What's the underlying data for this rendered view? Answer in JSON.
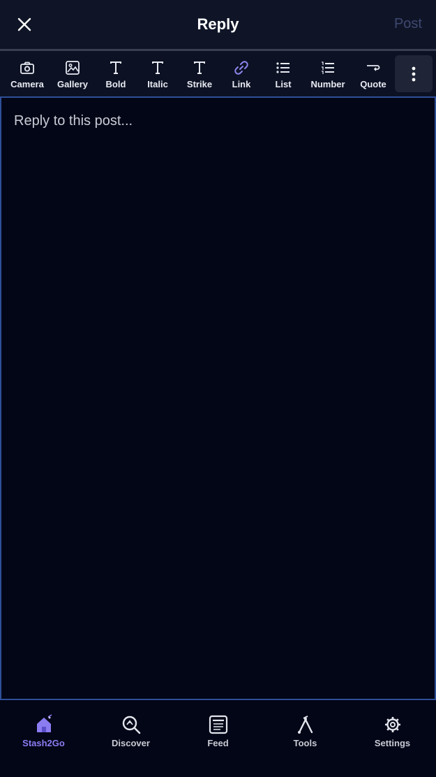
{
  "header": {
    "title": "Reply",
    "post_label": "Post",
    "close_icon": "close-icon"
  },
  "toolbar": {
    "items": [
      {
        "label": "Camera",
        "icon": "camera-icon"
      },
      {
        "label": "Gallery",
        "icon": "image-icon"
      },
      {
        "label": "Bold",
        "icon": "bold-icon"
      },
      {
        "label": "Italic",
        "icon": "italic-icon"
      },
      {
        "label": "Strike",
        "icon": "strikethrough-icon"
      },
      {
        "label": "Link",
        "icon": "link-icon"
      },
      {
        "label": "List",
        "icon": "bulleted-list-icon"
      },
      {
        "label": "Number",
        "icon": "numbered-list-icon"
      },
      {
        "label": "Quote",
        "icon": "quote-icon"
      }
    ],
    "more_icon": "more-vertical-icon"
  },
  "editor": {
    "placeholder": "Reply to this post...",
    "value": ""
  },
  "bottom_nav": {
    "items": [
      {
        "label": "Stash2Go",
        "icon": "home-icon",
        "active": true
      },
      {
        "label": "Discover",
        "icon": "discover-search-icon",
        "active": false
      },
      {
        "label": "Feed",
        "icon": "feed-icon",
        "active": false
      },
      {
        "label": "Tools",
        "icon": "tools-icon",
        "active": false
      },
      {
        "label": "Settings",
        "icon": "gear-icon",
        "active": false
      }
    ]
  },
  "colors": {
    "background": "#030617",
    "header_bg": "#0f1527",
    "accent": "#8b7cf2",
    "link_icon": "#8f86ee",
    "post_disabled": "#3f4870",
    "editor_border": "#2f4f98"
  }
}
